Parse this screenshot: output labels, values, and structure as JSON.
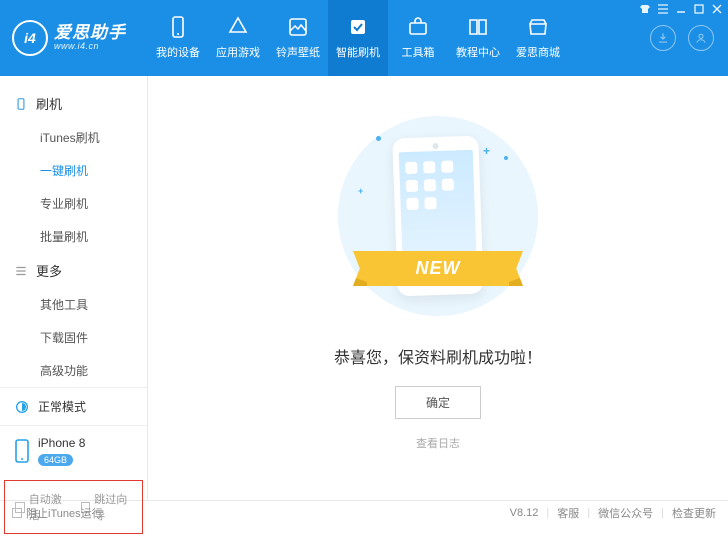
{
  "app": {
    "title": "爱思助手",
    "subtitle": "www.i4.cn"
  },
  "top_tabs": [
    {
      "label": "我的设备"
    },
    {
      "label": "应用游戏"
    },
    {
      "label": "铃声壁纸"
    },
    {
      "label": "智能刷机"
    },
    {
      "label": "工具箱"
    },
    {
      "label": "教程中心"
    },
    {
      "label": "爱思商城"
    }
  ],
  "sidebar": {
    "group1_title": "刷机",
    "group1_items": [
      "iTunes刷机",
      "一键刷机",
      "专业刷机",
      "批量刷机"
    ],
    "group2_title": "更多",
    "group2_items": [
      "其他工具",
      "下载固件",
      "高级功能"
    ]
  },
  "status_mode": "正常模式",
  "device": {
    "name": "iPhone 8",
    "capacity": "64GB"
  },
  "options": {
    "auto_activate": "自动激活",
    "skip_guide": "跳过向导"
  },
  "main": {
    "new_label": "NEW",
    "success_text": "恭喜您，保资料刷机成功啦！",
    "ok_label": "确定",
    "log_label": "查看日志"
  },
  "statusbar": {
    "block_itunes": "阻止iTunes运行",
    "version": "V8.12",
    "support": "客服",
    "wechat": "微信公众号",
    "update": "检查更新"
  }
}
